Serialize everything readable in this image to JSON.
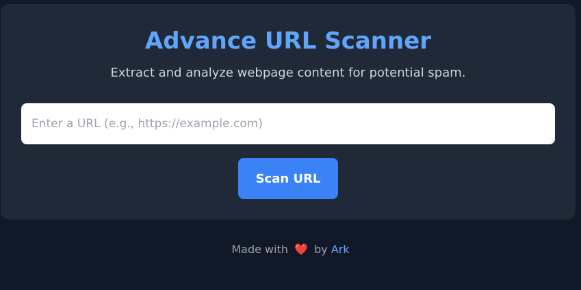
{
  "scanner": {
    "title": "Advance URL Scanner",
    "subtitle": "Extract and analyze webpage content for potential spam.",
    "url_input": {
      "value": "",
      "placeholder": "Enter a URL (e.g., https://example.com)"
    },
    "scan_button_label": "Scan URL"
  },
  "footer": {
    "prefix": "Made with",
    "heart_icon": "heart-icon",
    "heart_glyph": "❤️",
    "by": "by",
    "author": "Ark"
  },
  "colors": {
    "page_bg": "#111827",
    "card_bg": "#1f2937",
    "accent": "#60a5fa",
    "button": "#3b82f6",
    "heart": "#ef4444"
  }
}
